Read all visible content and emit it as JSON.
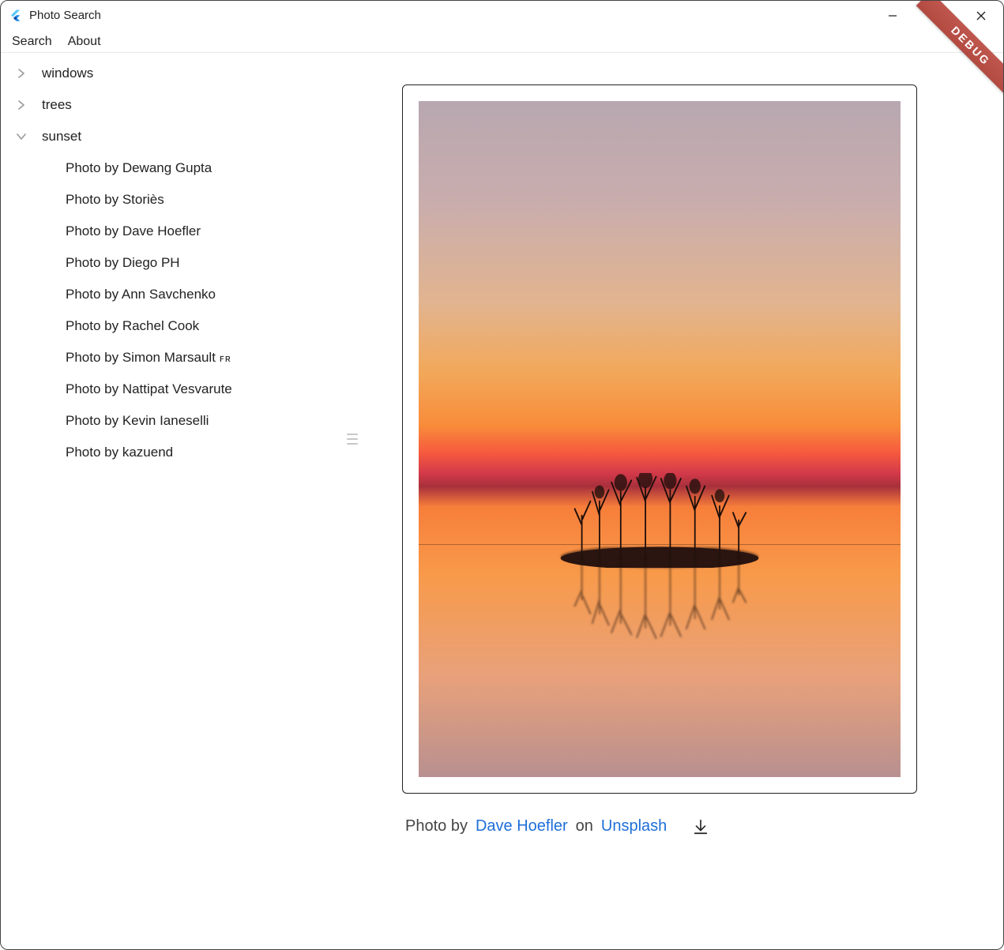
{
  "window": {
    "title": "Photo Search"
  },
  "menubar": {
    "search": "Search",
    "about": "About"
  },
  "tree": {
    "nodes": [
      {
        "label": "windows",
        "expanded": false
      },
      {
        "label": "trees",
        "expanded": false
      },
      {
        "label": "sunset",
        "expanded": true
      }
    ],
    "sunset_children": [
      "Photo by Dewang Gupta",
      "Photo by Storiès",
      "Photo by Dave Hoefler",
      "Photo by Diego PH",
      "Photo by Ann Savchenko",
      "Photo by Rachel Cook",
      "Photo by Simon Marsault ",
      "Photo by Nattipat Vesvarute",
      "Photo by Kevin Ianeselli",
      "Photo by kazuend"
    ],
    "marsault_suffix": "ꜰʀ"
  },
  "detail": {
    "caption_prefix": "Photo by",
    "author": "Dave Hoefler",
    "on": "on",
    "source": "Unsplash"
  },
  "debug_label": "DEBUG"
}
